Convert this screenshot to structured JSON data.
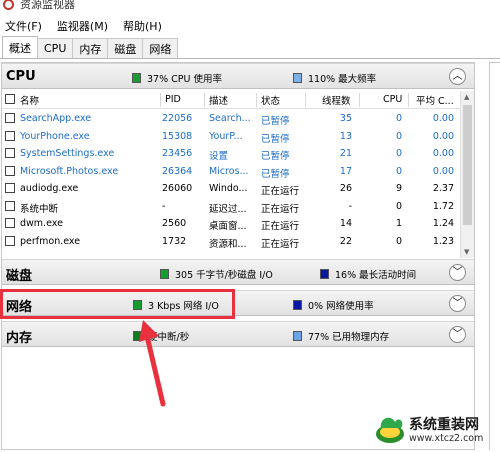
{
  "window": {
    "title": "资源监视器"
  },
  "menu": [
    "文件(F)",
    "监视器(M)",
    "帮助(H)"
  ],
  "tabs": [
    "概述",
    "CPU",
    "内存",
    "磁盘",
    "网络"
  ],
  "colors": {
    "cpu_usage": "#1a9c33",
    "max_freq": "#7fb0e8",
    "disk_io": "#14a02c",
    "disk_time": "#0a1aa0",
    "net_io": "#149c2c",
    "net_usage": "#0a18a8",
    "mem_fault": "#127a22",
    "mem_used": "#6aa6e6",
    "highlight": "#e8303f",
    "suspended_text": "#1d6cc7"
  },
  "sections": {
    "cpu": {
      "title": "CPU",
      "metric1": "37% CPU 使用率",
      "metric2": "110% 最大频率",
      "collapse_icon": "chevron-up-icon"
    },
    "disk": {
      "title": "磁盘",
      "metric1": "305 千字节/秒磁盘 I/O",
      "metric2": "16% 最长活动时间",
      "collapse_icon": "chevron-down-icon"
    },
    "network": {
      "title": "网络",
      "metric1": "3 Kbps 网络 I/O",
      "metric2": "0% 网络使用率",
      "collapse_icon": "chevron-down-icon"
    },
    "memory": {
      "title": "内存",
      "metric1": "硬中断/秒",
      "metric2": "77% 已用物理内存",
      "collapse_icon": "chevron-down-icon"
    }
  },
  "cpu_table": {
    "columns": [
      "名称",
      "PID",
      "描述",
      "状态",
      "线程数",
      "CPU",
      "平均 C..."
    ],
    "rows": [
      [
        "SearchApp.exe",
        "22056",
        "Search...",
        "已暂停",
        "35",
        "0",
        "0.00"
      ],
      [
        "YourPhone.exe",
        "15308",
        "YourP...",
        "已暂停",
        "13",
        "0",
        "0.00"
      ],
      [
        "SystemSettings.exe",
        "23456",
        "设置",
        "已暂停",
        "21",
        "0",
        "0.00"
      ],
      [
        "Microsoft.Photos.exe",
        "26364",
        "Micros...",
        "已暂停",
        "17",
        "0",
        "0.00"
      ],
      [
        "audiodg.exe",
        "26060",
        "Windo...",
        "正在运行",
        "26",
        "9",
        "2.37"
      ],
      [
        "系统中断",
        "-",
        "延迟过...",
        "正在运行",
        "-",
        "0",
        "1.72"
      ],
      [
        "dwm.exe",
        "2560",
        "桌面窗...",
        "正在运行",
        "14",
        "1",
        "1.24"
      ],
      [
        "perfmon.exe",
        "1732",
        "资源和...",
        "正在运行",
        "22",
        "0",
        "1.23"
      ]
    ],
    "suspended_flags": [
      true,
      true,
      true,
      true,
      false,
      false,
      false,
      false
    ]
  },
  "watermark": {
    "text": "系统重装网",
    "url": "www.xtcz2.com"
  }
}
